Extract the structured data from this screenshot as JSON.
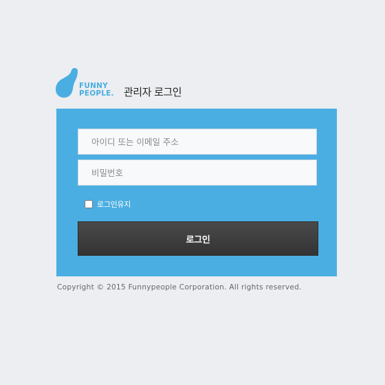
{
  "brand": {
    "logo_line1": "FUNNY",
    "logo_line2": "PEOPLE.",
    "logo_color": "#4aaee2",
    "logo_icon": "drop-icon"
  },
  "page_title": "관리자 로그인",
  "login_form": {
    "id_placeholder": "아이디 또는 이메일 주소",
    "password_placeholder": "비밀번호",
    "keep_login_label": "로그인유지",
    "keep_login_checked": false,
    "submit_label": "로그인"
  },
  "footer": {
    "copyright": "Copyright © 2015 Funnypeople Corporation. All rights reserved."
  },
  "colors": {
    "background": "#eceef1",
    "panel": "#4aaee2",
    "button": "#3a3a3a"
  }
}
